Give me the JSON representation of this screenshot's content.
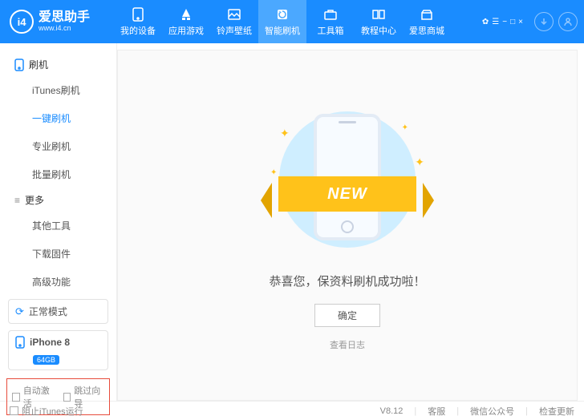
{
  "app": {
    "name": "爱思助手",
    "subtitle": "www.i4.cn",
    "logo_text": "i4"
  },
  "nav": {
    "items": [
      {
        "label": "我的设备"
      },
      {
        "label": "应用游戏"
      },
      {
        "label": "铃声壁纸"
      },
      {
        "label": "智能刷机"
      },
      {
        "label": "工具箱"
      },
      {
        "label": "教程中心"
      },
      {
        "label": "爱思商城"
      }
    ],
    "active_index": 3
  },
  "titlebar_icons": [
    "✿",
    "☰",
    "−",
    "□",
    "×"
  ],
  "sidebar": {
    "sections": [
      {
        "title": "刷机",
        "items": [
          "iTunes刷机",
          "一键刷机",
          "专业刷机",
          "批量刷机"
        ],
        "active": 1
      },
      {
        "title": "更多",
        "items": [
          "其他工具",
          "下载固件",
          "高级功能"
        ],
        "active": -1
      }
    ],
    "mode": "正常模式",
    "device": {
      "name": "iPhone 8",
      "storage": "64GB"
    },
    "options": [
      "自动激活",
      "跳过向导"
    ]
  },
  "content": {
    "ribbon_text": "NEW",
    "message": "恭喜您，保资料刷机成功啦！",
    "confirm": "确定",
    "view_log": "查看日志"
  },
  "footer": {
    "block_itunes": "阻止iTunes运行",
    "version": "V8.12",
    "links": [
      "客服",
      "微信公众号",
      "检查更新"
    ]
  }
}
